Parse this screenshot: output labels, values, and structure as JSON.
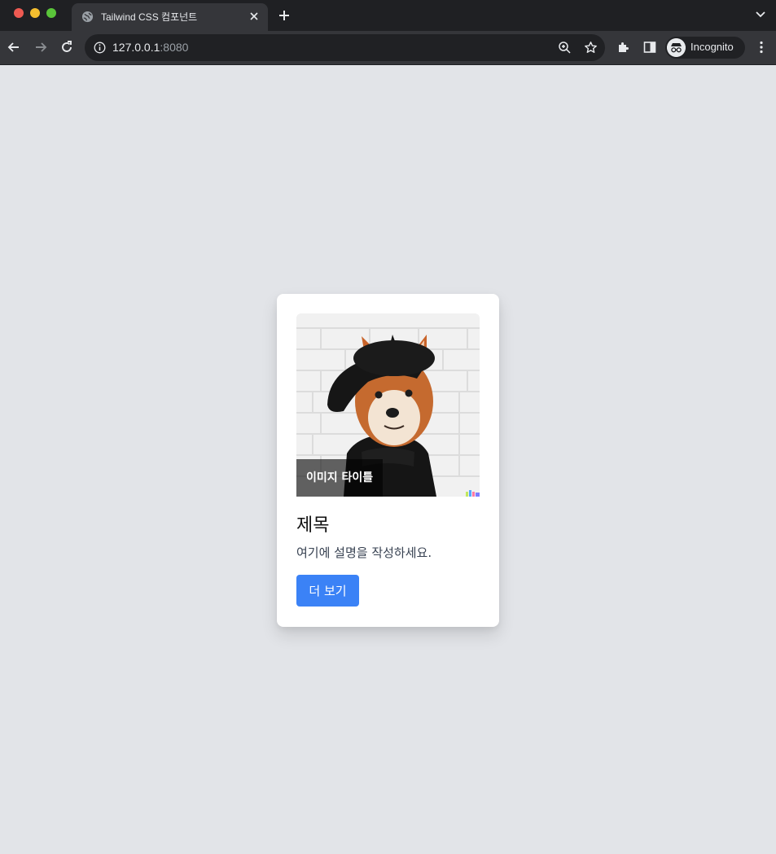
{
  "browser": {
    "tab": {
      "title": "Tailwind CSS 컴포넌트",
      "favicon": "globe-icon"
    },
    "address": {
      "host": "127.0.0.1",
      "port": ":8080"
    },
    "profile": {
      "label": "Incognito",
      "icon": "incognito-icon"
    },
    "colors": {
      "chrome_dark": "#1f2023",
      "chrome_toolbar": "#35363a",
      "omnibox": "#202124",
      "text": "#e8eaed"
    }
  },
  "card": {
    "image_caption": "이미지 타이틀",
    "title": "제목",
    "description": "여기에 설명을 작성하세요.",
    "button_label": "더 보기",
    "colors": {
      "button": "#3b82f6",
      "card_bg": "#ffffff",
      "page_bg": "#e2e4e8",
      "caption_overlay": "rgba(0,0,0,0.6)"
    }
  }
}
